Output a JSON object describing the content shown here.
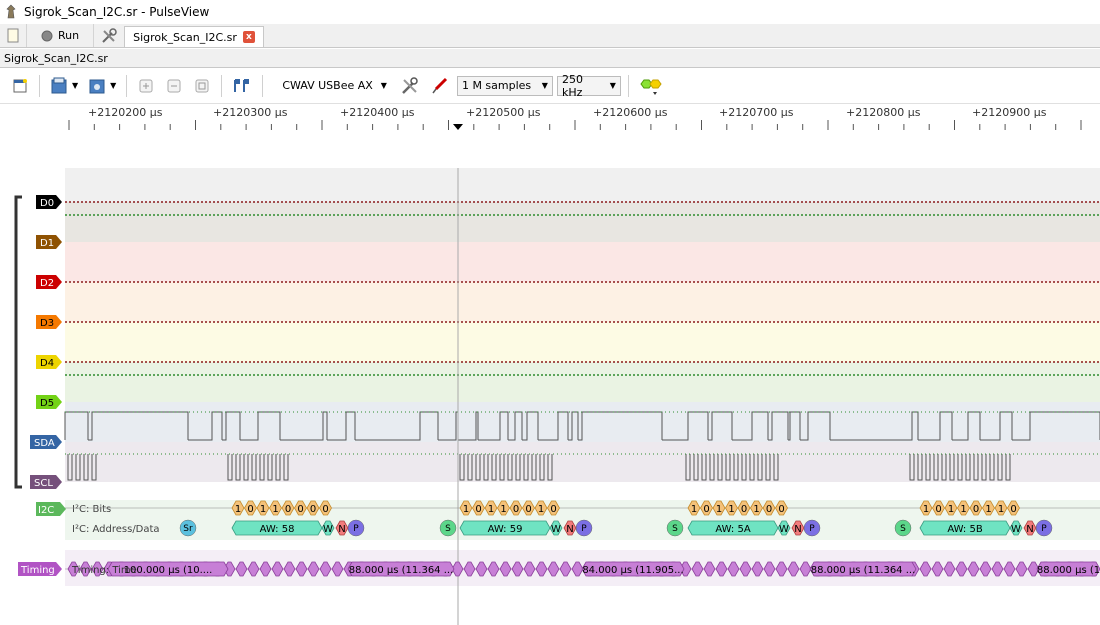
{
  "window": {
    "title": "Sigrok_Scan_I2C.sr - PulseView"
  },
  "tabbar": {
    "run_label": "Run",
    "session_tab_label": "Sigrok_Scan_I2C.sr",
    "close_glyph": "x"
  },
  "session": {
    "name": "Sigrok_Scan_I2C.sr"
  },
  "toolbar": {
    "device_name": "CWAV USBee AX",
    "samples": "1 M samples",
    "samplerate": "250 kHz",
    "icons": [
      "new-view-icon",
      "open-file-icon",
      "save-file-icon",
      "zoom-in-icon",
      "zoom-out-icon",
      "zoom-fit-icon",
      "cursor-icon",
      "configure-device-icon",
      "probe-icon",
      "decoders-icon"
    ]
  },
  "ruler": {
    "labels": [
      "+2120200 μs",
      "+2120300 μs",
      "+2120400 μs",
      "+2120500 μs",
      "+2120600 μs",
      "+2120700 μs",
      "+2120800 μs",
      "+2120900 μs"
    ]
  },
  "channels": [
    {
      "name": "D0",
      "color": "#000000",
      "text": "#ffffff",
      "bg": "#f0f0f0"
    },
    {
      "name": "D1",
      "color": "#8f5202",
      "text": "#ffffff",
      "bg": "#e8e6e1"
    },
    {
      "name": "D2",
      "color": "#cc0000",
      "text": "#ffffff",
      "bg": "#fbe7e5"
    },
    {
      "name": "D3",
      "color": "#f57900",
      "text": "#000000",
      "bg": "#fdf1e4"
    },
    {
      "name": "D4",
      "color": "#edd400",
      "text": "#000000",
      "bg": "#fdfbe4"
    },
    {
      "name": "D5",
      "color": "#73d216",
      "text": "#000000",
      "bg": "#eaf3e3"
    },
    {
      "name": "SDA",
      "color": "#3465a4",
      "text": "#ffffff",
      "bg": "#e8ecf1"
    },
    {
      "name": "SCL",
      "color": "#75507b",
      "text": "#ffffff",
      "bg": "#ede9ee"
    }
  ],
  "decoders": {
    "i2c": {
      "label": "I2C",
      "color": "#5cb85c",
      "rows": [
        "I²C: Bits",
        "I²C: Address/Data"
      ],
      "frames": [
        {
          "bits": [
            "1",
            "0",
            "1",
            "1",
            "0",
            "0",
            "0",
            "0"
          ],
          "sr": "Sr",
          "addr": "AW: 58",
          "w": "W",
          "n": "N",
          "p": "P"
        },
        {
          "bits": [
            "1",
            "0",
            "1",
            "1",
            "0",
            "0",
            "1",
            "0"
          ],
          "s": "S",
          "addr": "AW: 59",
          "w": "W",
          "n": "N",
          "p": "P"
        },
        {
          "bits": [
            "1",
            "0",
            "1",
            "1",
            "0",
            "1",
            "0",
            "0"
          ],
          "s": "S",
          "addr": "AW: 5A",
          "w": "W",
          "n": "N",
          "p": "P"
        },
        {
          "bits": [
            "1",
            "0",
            "1",
            "1",
            "0",
            "1",
            "1",
            "0"
          ],
          "s": "S",
          "addr": "AW: 5B",
          "w": "W",
          "n": "N",
          "p": "P"
        }
      ]
    },
    "timing": {
      "label": "Timing",
      "color": "#b154c4",
      "row": "Timing: Time",
      "values": [
        "100.000 μs (10....",
        "88.000 μs (11.364 ...",
        "84.000 μs (11.905...",
        "88.000 μs (11.364 ...",
        "88.000 μs (1"
      ]
    }
  }
}
